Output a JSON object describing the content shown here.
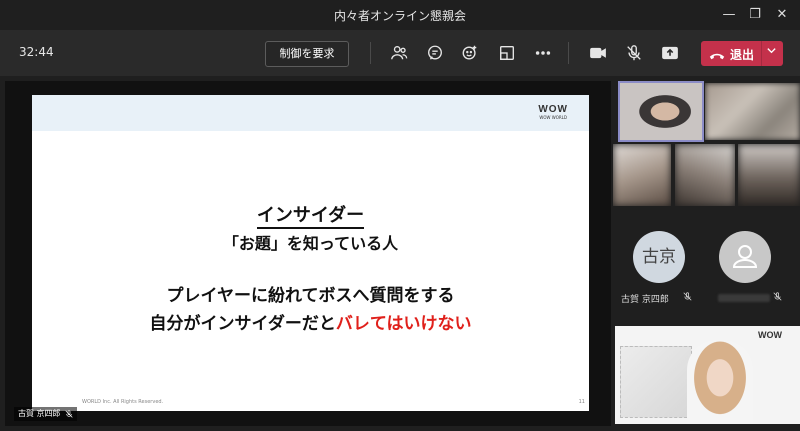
{
  "window": {
    "title": "内々者オンライン懇親会"
  },
  "toolbar": {
    "timer": "32:44",
    "control_request_label": "制御を要求",
    "leave_label": "退出"
  },
  "slide": {
    "title": "インサイダー",
    "subtitle": "「お題」を知っている人",
    "line3": "プレイヤーに紛れてボスへ質問をする",
    "line4_prefix": "自分がインサイダーだと",
    "line4_highlight": "バレてはいけない",
    "logo_main": "WOW",
    "logo_sub": "WOW WORLD",
    "footer": "WORLD Inc. All Rights Reserved.",
    "page_number": "11"
  },
  "presenter": {
    "name": "古賀 京四郎"
  },
  "participants": [
    {
      "name": "古賀 京四郎",
      "initials": "古京"
    }
  ],
  "colors": {
    "leave": "#c4314b",
    "highlight": "#e0201b",
    "active_tile": "#8b8cc7"
  }
}
